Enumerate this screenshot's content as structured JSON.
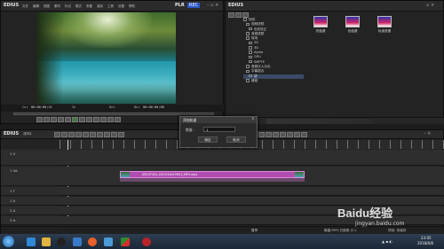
{
  "player": {
    "brand": "EDIUS",
    "menus": [
      "文件",
      "编辑",
      "视图",
      "素材",
      "标记",
      "模式",
      "采集",
      "渲染",
      "工具",
      "设置",
      "帮助"
    ],
    "mode": "PLR",
    "rec": "REC",
    "cur_tc_label": "Cur",
    "cur_tc": "00:00:00;21",
    "in_label": "In",
    "out_label": "Out",
    "dur_label": "Dur",
    "dur_tc": "00:00:00;00"
  },
  "effects": {
    "brand": "EDIUS",
    "tree": [
      "特效",
      "视频滤镜",
      "色彩校正",
      "音频滤镜",
      "转场",
      "2D",
      "3D",
      "Alpha",
      "GPU",
      "SMPTE",
      "音频淡入淡出",
      "字幕混合",
      "键",
      "键组"
    ],
    "items": [
      "亮度键",
      "色度键",
      "轨道遮罩"
    ]
  },
  "dialog": {
    "title": "添加轨道",
    "count_label": "数量:",
    "count_value": "1",
    "ok": "确定",
    "cancel": "取消"
  },
  "timeline": {
    "brand": "EDIUS",
    "seq_tab": "序列1",
    "tracks": [
      "1 V",
      "1 VA",
      "1 T",
      "1 A",
      "2 A",
      "3 A"
    ],
    "clip_label": "DSC07304_1611054415M13_MP4.mp4",
    "status_left": "暂停",
    "status_mid": "磁盘:99% 已使用 (C:)",
    "status_right": "项目: 未保存"
  },
  "taskbar": {
    "time": "23:05",
    "date": "2018/6/8"
  },
  "watermark": {
    "text": "Baidu经验",
    "url": "jingyan.baidu.com"
  }
}
